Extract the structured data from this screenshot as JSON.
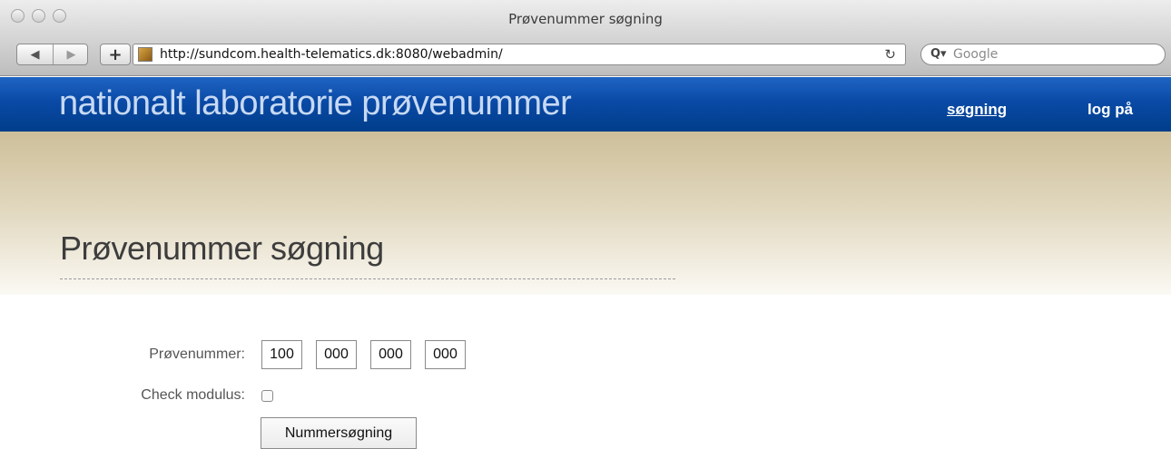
{
  "window": {
    "title": "Prøvenummer søgning"
  },
  "toolbar": {
    "back_glyph": "◀",
    "forward_glyph": "▶",
    "add_glyph": "+",
    "url": "http://sundcom.health-telematics.dk:8080/webadmin/",
    "reload_glyph": "↻",
    "search_placeholder": "Google",
    "search_glyph": "Q▾"
  },
  "banner": {
    "site_title": "nationalt laboratorie prøvenummer",
    "nav": [
      {
        "label": "søgning",
        "active": true
      },
      {
        "label": "log på",
        "active": false
      }
    ],
    "colors": {
      "banner": "#0a4aa6",
      "title": "#c7d9f3"
    }
  },
  "page": {
    "title": "Prøvenummer søgning"
  },
  "form": {
    "number_label": "Prøvenummer:",
    "number_parts": [
      "100",
      "000",
      "000",
      "000"
    ],
    "modulus_label": "Check modulus:",
    "modulus_checked": false,
    "submit_label": "Nummersøgning"
  }
}
